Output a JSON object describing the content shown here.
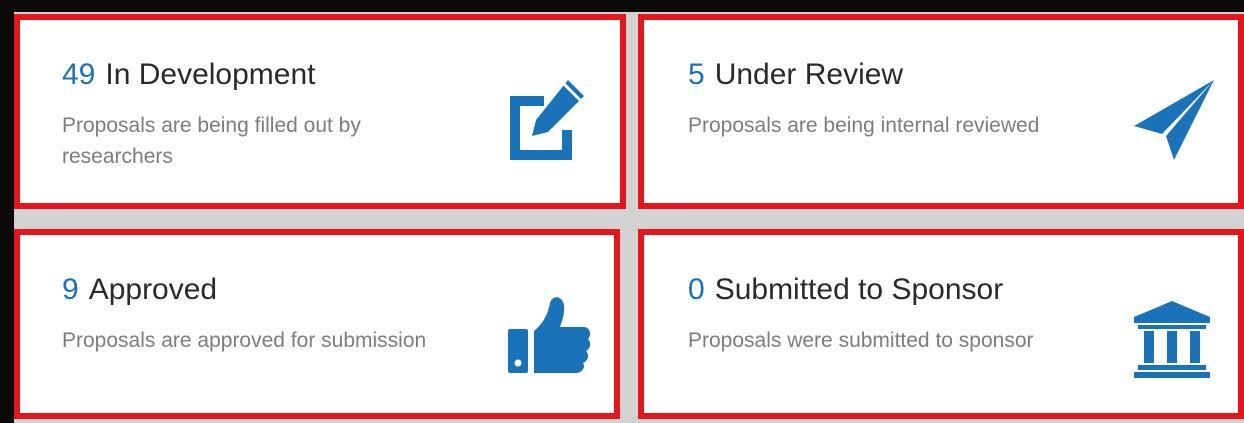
{
  "cards": [
    {
      "count": "49",
      "title": "In Development",
      "description": "Proposals are being filled out by researchers",
      "icon": "edit-icon"
    },
    {
      "count": "5",
      "title": "Under Review",
      "description": "Proposals are being internal reviewed",
      "icon": "paper-plane-icon"
    },
    {
      "count": "9",
      "title": "Approved",
      "description": "Proposals are approved for submission",
      "icon": "thumbs-up-icon"
    },
    {
      "count": "0",
      "title": "Submitted to Sponsor",
      "description": "Proposals were submitted to sponsor",
      "icon": "institution-icon"
    }
  ],
  "colors": {
    "accent": "#1a73b8",
    "highlight_border": "#e8141c",
    "title_text": "#2a2a2a",
    "description_text": "#7d7d7d",
    "gutter": "#d2d2d2"
  }
}
